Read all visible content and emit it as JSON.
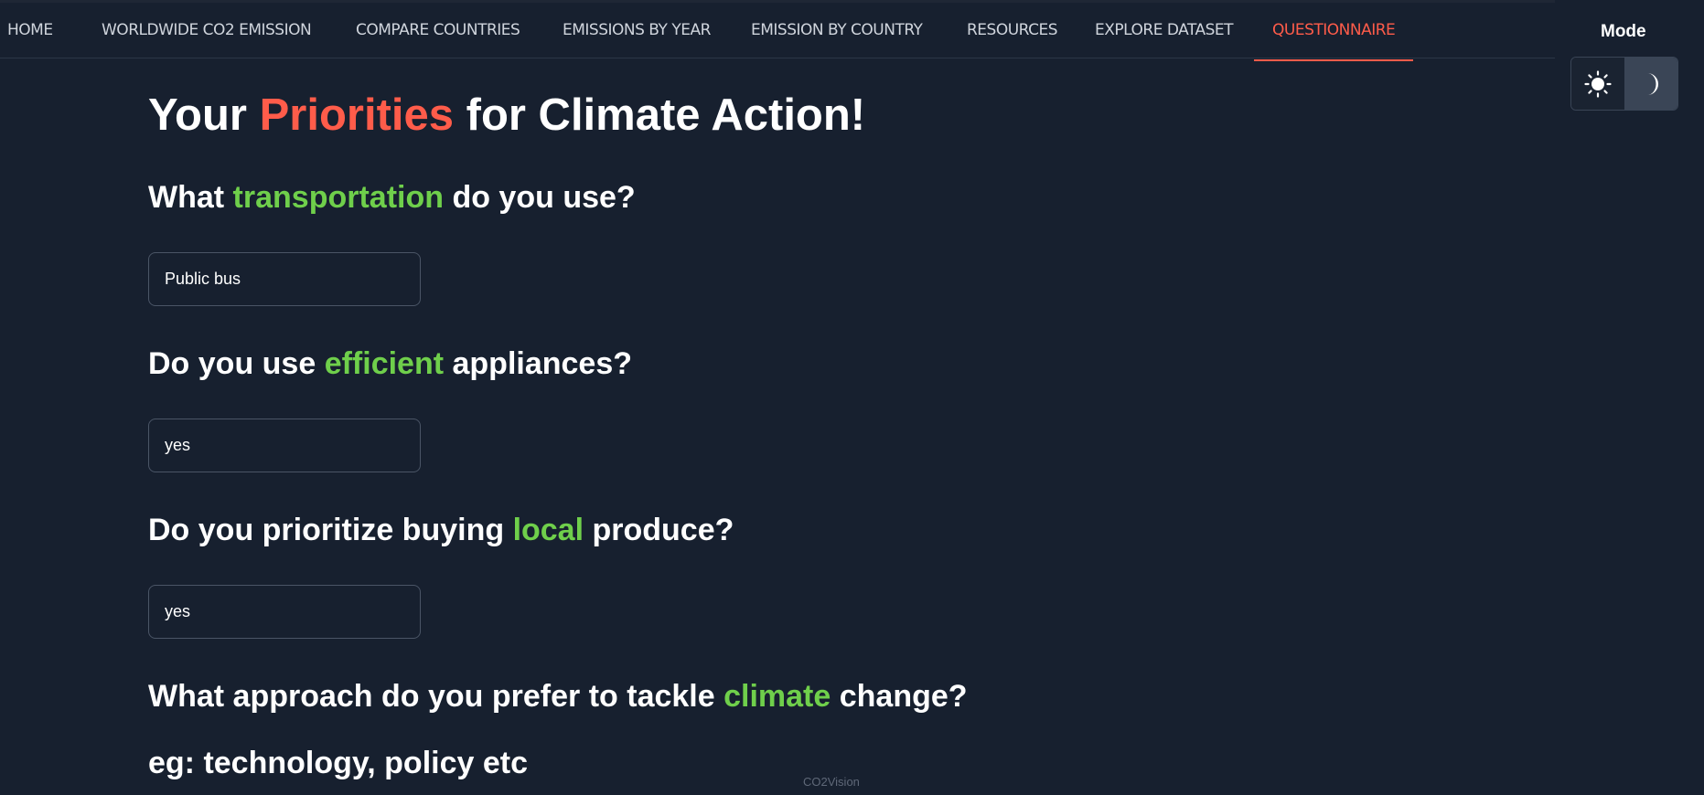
{
  "nav": {
    "items": [
      {
        "label": "HOME",
        "active": false
      },
      {
        "label": "WORLDWIDE CO2 EMISSION",
        "active": false
      },
      {
        "label": "COMPARE COUNTRIES",
        "active": false
      },
      {
        "label": "EMISSIONS BY YEAR",
        "active": false
      },
      {
        "label": "EMISSION BY COUNTRY",
        "active": false
      },
      {
        "label": "RESOURCES",
        "active": false
      },
      {
        "label": "EXPLORE DATASET",
        "active": false
      },
      {
        "label": "QUESTIONNAIRE",
        "active": true
      }
    ]
  },
  "mode": {
    "label": "Mode",
    "selected": "dark",
    "light_icon": "sun-icon",
    "dark_icon": "moon-icon"
  },
  "title": {
    "prefix": "Your ",
    "highlight": "Priorities",
    "suffix": " for Climate Action!"
  },
  "questions": [
    {
      "prefix": "What ",
      "highlight": "transportation",
      "suffix": " do you use?",
      "answer": "Public bus"
    },
    {
      "prefix": "Do you use ",
      "highlight": "efficient",
      "suffix": " appliances?",
      "answer": "yes"
    },
    {
      "prefix": "Do you prioritize buying ",
      "highlight": "local",
      "suffix": " produce?",
      "answer": "yes"
    },
    {
      "prefix": "What approach do you prefer to tackle ",
      "highlight": "climate",
      "suffix": " change?"
    }
  ],
  "hint": "eg: technology, policy etc",
  "footer": "CO2Vision",
  "colors": {
    "background": "#17202f",
    "accent_red": "#ff5c4a",
    "accent_green": "#6fcf4b"
  }
}
